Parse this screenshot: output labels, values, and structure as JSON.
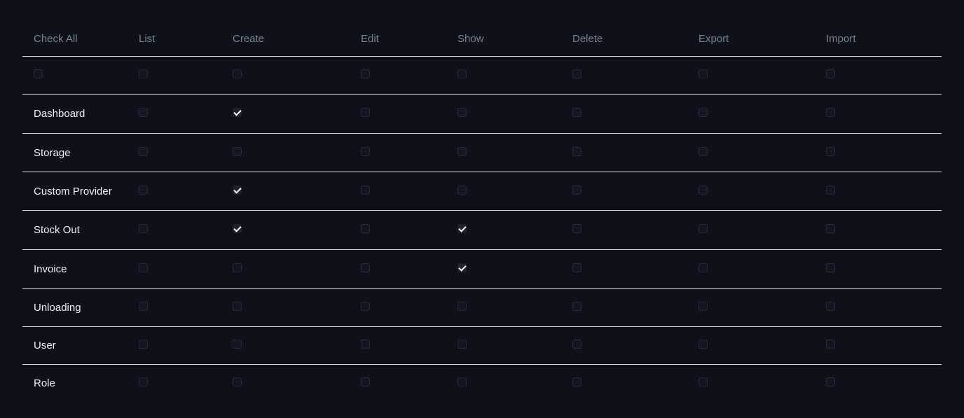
{
  "columns": [
    "Check All",
    "List",
    "Create",
    "Edit",
    "Show",
    "Delete",
    "Export",
    "Import"
  ],
  "check_all_row": [
    false,
    false,
    false,
    false,
    false,
    false,
    false,
    false
  ],
  "rows": [
    {
      "label": "Dashboard",
      "perms": [
        false,
        true,
        false,
        false,
        false,
        false,
        false
      ]
    },
    {
      "label": "Storage",
      "perms": [
        false,
        false,
        false,
        false,
        false,
        false,
        false
      ]
    },
    {
      "label": "Custom Provider",
      "perms": [
        false,
        true,
        false,
        false,
        false,
        false,
        false
      ]
    },
    {
      "label": "Stock Out",
      "perms": [
        false,
        true,
        false,
        true,
        false,
        false,
        false
      ]
    },
    {
      "label": "Invoice",
      "perms": [
        false,
        false,
        false,
        true,
        false,
        false,
        false
      ]
    },
    {
      "label": "Unloading",
      "perms": [
        false,
        false,
        false,
        false,
        false,
        false,
        false
      ]
    },
    {
      "label": "User",
      "perms": [
        false,
        false,
        false,
        false,
        false,
        false,
        false
      ]
    },
    {
      "label": "Role",
      "perms": [
        false,
        false,
        false,
        false,
        false,
        false,
        false
      ]
    }
  ],
  "colors": {
    "background": "#0d1119",
    "divider": "#d8dbe0",
    "header_text": "#7b8190",
    "row_text": "#eef0f3"
  }
}
